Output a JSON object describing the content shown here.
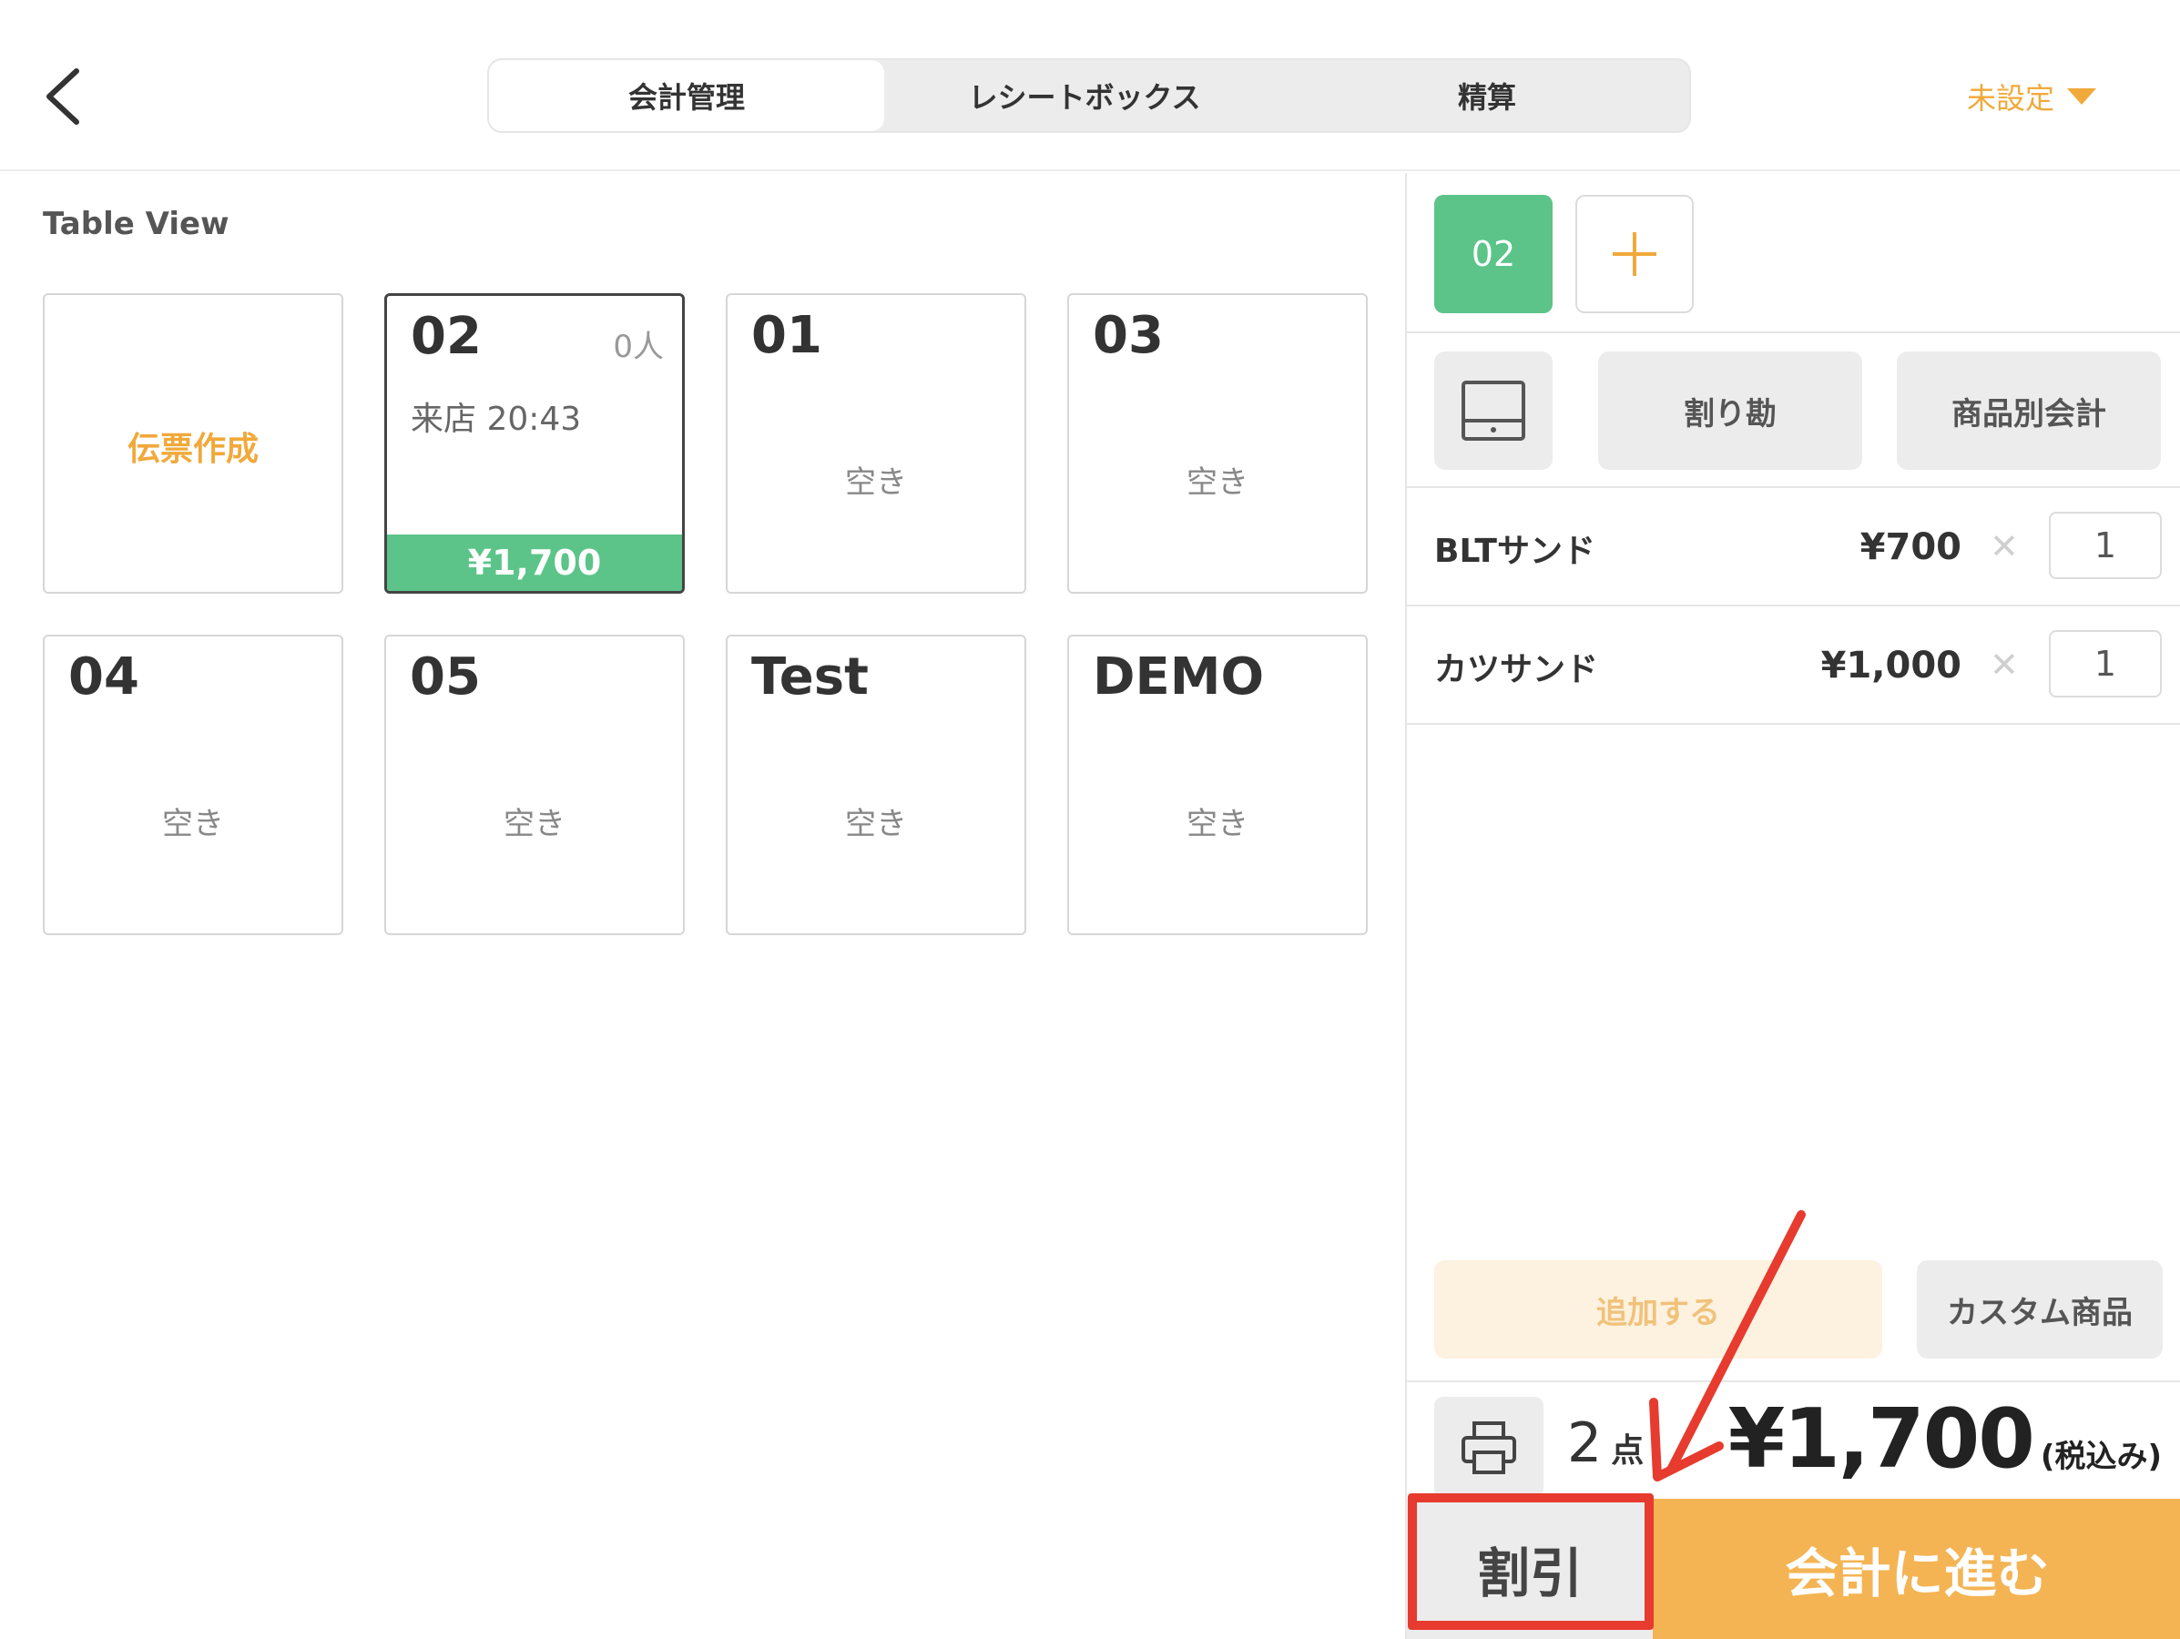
{
  "header": {
    "tabs": [
      "会計管理",
      "レシートボックス",
      "精算"
    ],
    "active_tab": 0,
    "setting_label": "未設定"
  },
  "table_view": {
    "title": "Table View",
    "create_label": "伝票作成",
    "tables": [
      {
        "name": "02",
        "guests": "0人",
        "arrival": "来店 20:43",
        "price": "¥1,700",
        "selected": true
      },
      {
        "name": "01",
        "status": "空き"
      },
      {
        "name": "03",
        "status": "空き"
      },
      {
        "name": "04",
        "status": "空き"
      },
      {
        "name": "05",
        "status": "空き"
      },
      {
        "name": "Test",
        "status": "空き"
      },
      {
        "name": "DEMO",
        "status": "空き"
      }
    ]
  },
  "order_panel": {
    "table_chip": "02",
    "actions": {
      "split": "割り勘",
      "by_item": "商品別会計"
    },
    "items": [
      {
        "name": "BLTサンド",
        "price": "¥700",
        "qty": "1"
      },
      {
        "name": "カツサンド",
        "price": "¥1,000",
        "qty": "1"
      }
    ],
    "add_label": "追加する",
    "custom_label": "カスタム商品",
    "count": "2",
    "count_unit": "点",
    "total": "¥1,700",
    "tax_note": "(税込み)",
    "discount_label": "割引",
    "checkout_label": "会計に進む"
  },
  "colors": {
    "accent_orange": "#f0a93b",
    "accent_green": "#5cc489",
    "highlight_red": "#e63b2e"
  }
}
